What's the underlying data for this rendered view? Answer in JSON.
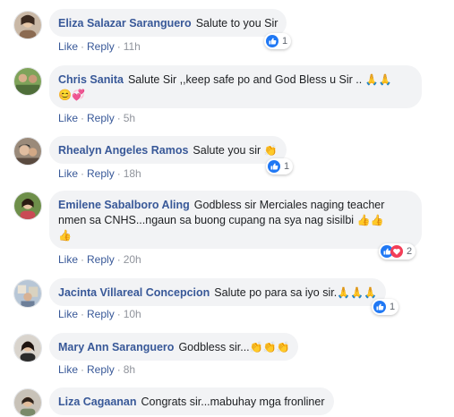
{
  "actions": {
    "like": "Like",
    "reply": "Reply",
    "separator": "·"
  },
  "comments": [
    {
      "author": "Eliza Salazar Saranguero",
      "text": "Salute to you Sir",
      "time": "11h",
      "reactions": "1"
    },
    {
      "author": "Chris Sanita",
      "text": "Salute Sir ,,keep safe po and God Bless u Sir .. ",
      "emojis_line1": "🙏🙏",
      "emojis_line2": "😊💞",
      "time": "5h"
    },
    {
      "author": "Rhealyn Angeles Ramos",
      "text": "Salute you sir ",
      "emojis": "👏",
      "time": "18h",
      "reactions": "1"
    },
    {
      "author": "Emilene Sabalboro Aling",
      "text_line1": "Godbless sir Merciales naging teacher",
      "text_line2": "nmen sa CNHS...ngaun sa buong cupang na sya nag sisilbi ",
      "emojis_line2": "👍👍",
      "emojis_line3": "👍",
      "time": "20h",
      "reactions": "2"
    },
    {
      "author": "Jacinta Villareal Concepcion",
      "text": "Salute po para sa iyo sir.",
      "emojis": "🙏🙏🙏",
      "time": "10h",
      "reactions": "1"
    },
    {
      "author": "Mary Ann Saranguero",
      "text": "Godbless sir...",
      "emojis": "👏👏👏",
      "time": "8h"
    },
    {
      "author": "Liza Cagaanan",
      "text": "Congrats sir...mabuhay mga fronliner"
    }
  ],
  "colors": {
    "author": "#385898",
    "bubble": "#f2f3f5",
    "like_blue": "#2078f4",
    "love_red": "#f33e58"
  }
}
